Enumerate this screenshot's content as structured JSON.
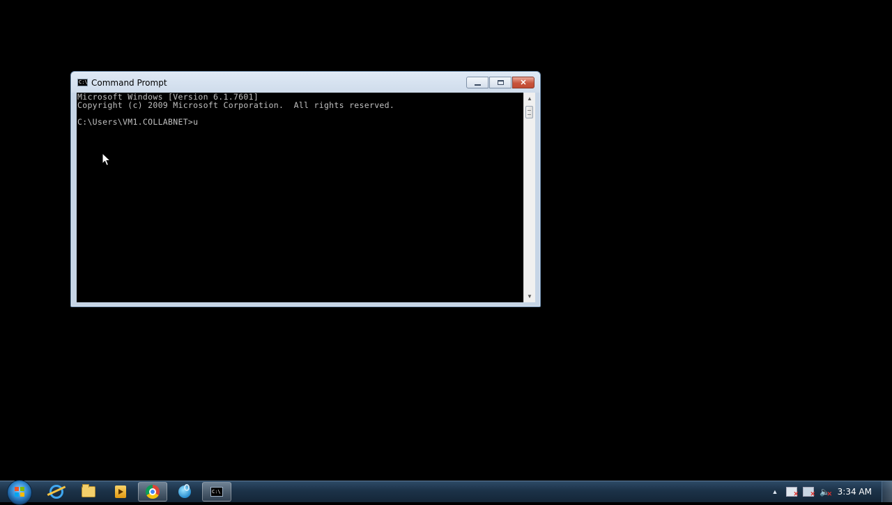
{
  "window": {
    "title": "Command Prompt",
    "title_icon_text": "C:\\",
    "buttons": {
      "minimize": "minimize",
      "maximize": "maximize",
      "close": "✕"
    }
  },
  "console": {
    "lines": [
      "Microsoft Windows [Version 6.1.7601]",
      "Copyright (c) 2009 Microsoft Corporation.  All rights reserved.",
      "",
      "C:\\Users\\VM1.COLLABNET>u"
    ]
  },
  "taskbar": {
    "pinned": [
      {
        "name": "internet-explorer",
        "icon": "ie-icon"
      },
      {
        "name": "windows-explorer",
        "icon": "folder-icon"
      },
      {
        "name": "media-player",
        "icon": "media-icon"
      },
      {
        "name": "google-chrome",
        "icon": "chrome-icon"
      },
      {
        "name": "network-app",
        "icon": "net-icon"
      },
      {
        "name": "command-prompt",
        "icon": "cmd-icon",
        "active": true
      }
    ],
    "cmd_icon_text": "C:\\",
    "tray": {
      "overflow_arrow": "▲",
      "clock": "3:34 AM"
    }
  }
}
